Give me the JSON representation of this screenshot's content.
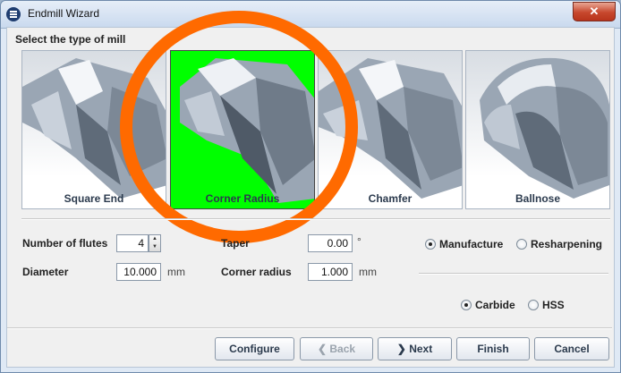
{
  "window": {
    "title": "Endmill Wizard",
    "close_symbol": "✕"
  },
  "section_title": "Select the type of mill",
  "mills": [
    {
      "label": "Square End",
      "selected": false
    },
    {
      "label": "Corner Radius",
      "selected": true
    },
    {
      "label": "Chamfer",
      "selected": false
    },
    {
      "label": "Ballnose",
      "selected": false
    }
  ],
  "highlight_color": "#00ff00",
  "annotation_color": "#ff6a00",
  "fields": {
    "flutes": {
      "label": "Number of flutes",
      "value": "4"
    },
    "diameter": {
      "label": "Diameter",
      "value": "10.000",
      "unit": "mm"
    },
    "taper": {
      "label": "Taper",
      "value": "0.00",
      "unit": "°"
    },
    "corner_radius": {
      "label": "Corner radius",
      "value": "1.000",
      "unit": "mm"
    }
  },
  "mode_options": [
    {
      "label": "Manufacture",
      "selected": true
    },
    {
      "label": "Resharpening",
      "selected": false
    }
  ],
  "material_options": [
    {
      "label": "Carbide",
      "selected": true
    },
    {
      "label": "HSS",
      "selected": false
    }
  ],
  "buttons": {
    "configure": "Configure",
    "back": "Back",
    "back_arrow": "❮",
    "next": "Next",
    "next_arrow": "❯",
    "finish": "Finish",
    "cancel": "Cancel"
  }
}
